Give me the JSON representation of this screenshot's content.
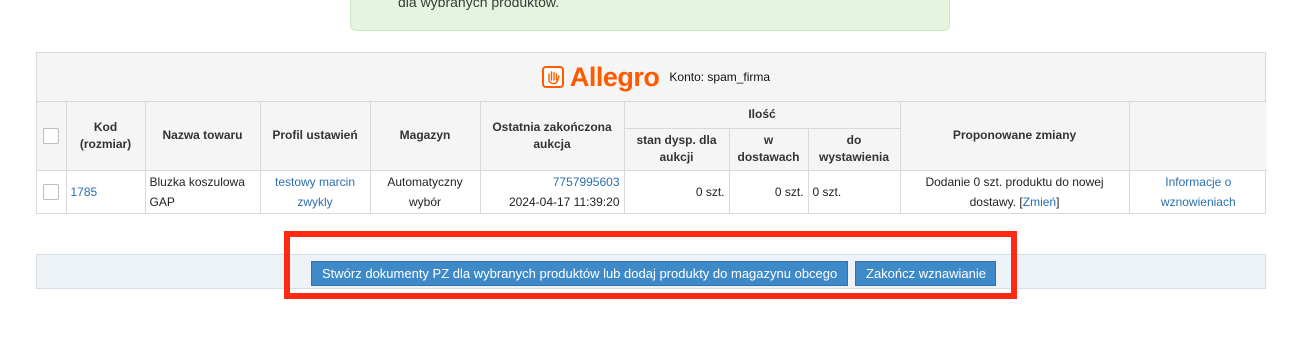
{
  "notice": {
    "text": "dla wybranych produktów."
  },
  "brand": {
    "logo_text": "Allegro",
    "account_label": "Konto: spam_firma",
    "icon": "allegro-hand-icon",
    "color": "#ff5a00"
  },
  "table": {
    "headers": {
      "kod": "Kod (rozmiar)",
      "nazwa": "Nazwa towaru",
      "profil": "Profil ustawień",
      "magazyn": "Magazyn",
      "aukcja": "Ostatnia zakończona aukcja",
      "ilosc": "Ilość",
      "stan": "stan dysp. dla aukcji",
      "dostawy": "w dostawach",
      "wystawienie": "do wystawienia",
      "zmiany": "Proponowane zmiany"
    },
    "rows": [
      {
        "kod": "1785",
        "nazwa": "Bluzka koszulowa GAP",
        "profil": "testowy marcin zwykly",
        "magazyn": "Automatyczny wybór",
        "aukcja_id": "7757995603",
        "aukcja_data": "2024-04-17 11:39:20",
        "stan": "0 szt.",
        "dostawy": "0 szt.",
        "wystawienie": "0 szt.",
        "zmiany_text": "Dodanie 0 szt. produktu do nowej dostawy.",
        "zmiany_link": "Zmień",
        "info_link": "Informacje o wznowieniach"
      }
    ]
  },
  "actions": {
    "create_label": "Stwórz dokumenty PZ dla wybranych produktów lub dodaj produkty do magazynu obcego",
    "finish_label": "Zakończ wznawianie"
  },
  "colors": {
    "accent": "#3e89c8",
    "link": "#2a6eb0",
    "highlight": "#ff2a14",
    "notice_bg": "#e6f3de"
  }
}
